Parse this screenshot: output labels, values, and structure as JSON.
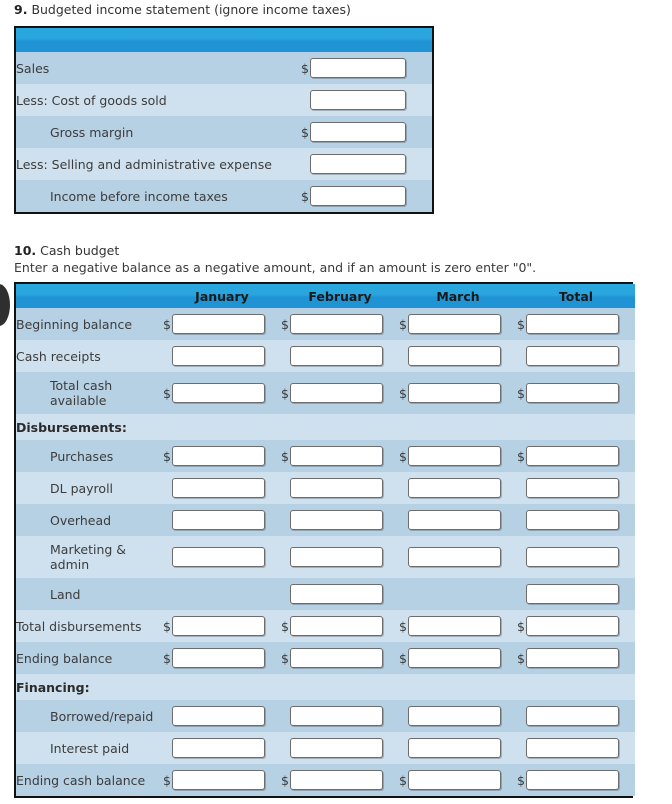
{
  "questions": {
    "q9": {
      "number": "9.",
      "title": "Budgeted income statement (ignore income taxes)",
      "table": {
        "headers": [
          "",
          ""
        ],
        "rows": [
          {
            "label": "Sales",
            "indent": false,
            "bold": false,
            "dollar": true,
            "input": true
          },
          {
            "label": "Less: Cost of goods sold",
            "indent": false,
            "bold": false,
            "dollar": false,
            "input": true
          },
          {
            "label": "Gross margin",
            "indent": true,
            "bold": false,
            "dollar": true,
            "input": true
          },
          {
            "label": "Less: Selling and administrative expense",
            "indent": false,
            "bold": false,
            "dollar": false,
            "input": true
          },
          {
            "label": "Income before income taxes",
            "indent": true,
            "bold": false,
            "dollar": true,
            "input": true
          }
        ]
      }
    },
    "q10": {
      "number": "10.",
      "title": "Cash budget",
      "instruction": "Enter a negative balance as a negative amount, and if an amount is zero enter \"0\".",
      "table": {
        "headers": [
          "",
          "January",
          "February",
          "March",
          "Total"
        ],
        "rows": [
          {
            "label": "Beginning balance",
            "indent": false,
            "bold": false,
            "tall": false,
            "cells": [
              {
                "dollar": true,
                "input": true
              },
              {
                "dollar": true,
                "input": true
              },
              {
                "dollar": true,
                "input": true
              },
              {
                "dollar": true,
                "input": true
              }
            ]
          },
          {
            "label": "Cash receipts",
            "indent": false,
            "bold": false,
            "tall": false,
            "cells": [
              {
                "dollar": false,
                "input": true
              },
              {
                "dollar": false,
                "input": true
              },
              {
                "dollar": false,
                "input": true
              },
              {
                "dollar": false,
                "input": true
              }
            ]
          },
          {
            "label": "Total cash available",
            "indent": true,
            "bold": false,
            "tall": true,
            "cells": [
              {
                "dollar": true,
                "input": true
              },
              {
                "dollar": true,
                "input": true
              },
              {
                "dollar": true,
                "input": true
              },
              {
                "dollar": true,
                "input": true
              }
            ]
          },
          {
            "label": "Disbursements:",
            "indent": false,
            "bold": true,
            "tall": false,
            "thin": true,
            "cells": [
              {
                "dollar": false,
                "input": false
              },
              {
                "dollar": false,
                "input": false
              },
              {
                "dollar": false,
                "input": false
              },
              {
                "dollar": false,
                "input": false
              }
            ]
          },
          {
            "label": "Purchases",
            "indent": true,
            "bold": false,
            "tall": false,
            "cells": [
              {
                "dollar": true,
                "input": true
              },
              {
                "dollar": true,
                "input": true
              },
              {
                "dollar": true,
                "input": true
              },
              {
                "dollar": true,
                "input": true
              }
            ]
          },
          {
            "label": "DL payroll",
            "indent": true,
            "bold": false,
            "tall": false,
            "cells": [
              {
                "dollar": false,
                "input": true
              },
              {
                "dollar": false,
                "input": true
              },
              {
                "dollar": false,
                "input": true
              },
              {
                "dollar": false,
                "input": true
              }
            ]
          },
          {
            "label": "Overhead",
            "indent": true,
            "bold": false,
            "tall": false,
            "cells": [
              {
                "dollar": false,
                "input": true
              },
              {
                "dollar": false,
                "input": true
              },
              {
                "dollar": false,
                "input": true
              },
              {
                "dollar": false,
                "input": true
              }
            ]
          },
          {
            "label": "Marketing & admin",
            "indent": true,
            "bold": false,
            "tall": true,
            "cells": [
              {
                "dollar": false,
                "input": true
              },
              {
                "dollar": false,
                "input": true
              },
              {
                "dollar": false,
                "input": true
              },
              {
                "dollar": false,
                "input": true
              }
            ]
          },
          {
            "label": "Land",
            "indent": true,
            "bold": false,
            "tall": false,
            "cells": [
              {
                "dollar": false,
                "input": false
              },
              {
                "dollar": false,
                "input": true
              },
              {
                "dollar": false,
                "input": false
              },
              {
                "dollar": false,
                "input": true
              }
            ]
          },
          {
            "label": "Total disbursements",
            "indent": false,
            "bold": false,
            "tall": false,
            "cells": [
              {
                "dollar": true,
                "input": true
              },
              {
                "dollar": true,
                "input": true
              },
              {
                "dollar": true,
                "input": true
              },
              {
                "dollar": true,
                "input": true
              }
            ]
          },
          {
            "label": "Ending balance",
            "indent": false,
            "bold": false,
            "tall": false,
            "cells": [
              {
                "dollar": true,
                "input": true
              },
              {
                "dollar": true,
                "input": true
              },
              {
                "dollar": true,
                "input": true
              },
              {
                "dollar": true,
                "input": true
              }
            ]
          },
          {
            "label": "Financing:",
            "indent": false,
            "bold": true,
            "tall": false,
            "thin": true,
            "cells": [
              {
                "dollar": false,
                "input": false
              },
              {
                "dollar": false,
                "input": false
              },
              {
                "dollar": false,
                "input": false
              },
              {
                "dollar": false,
                "input": false
              }
            ]
          },
          {
            "label": "Borrowed/repaid",
            "indent": true,
            "bold": false,
            "tall": false,
            "cells": [
              {
                "dollar": false,
                "input": true
              },
              {
                "dollar": false,
                "input": true
              },
              {
                "dollar": false,
                "input": true
              },
              {
                "dollar": false,
                "input": true
              }
            ]
          },
          {
            "label": "Interest paid",
            "indent": true,
            "bold": false,
            "tall": false,
            "cells": [
              {
                "dollar": false,
                "input": true
              },
              {
                "dollar": false,
                "input": true
              },
              {
                "dollar": false,
                "input": true
              },
              {
                "dollar": false,
                "input": true
              }
            ]
          },
          {
            "label": "Ending cash balance",
            "indent": false,
            "bold": false,
            "tall": false,
            "cells": [
              {
                "dollar": true,
                "input": true
              },
              {
                "dollar": true,
                "input": true
              },
              {
                "dollar": true,
                "input": true
              },
              {
                "dollar": true,
                "input": true
              }
            ]
          }
        ]
      }
    }
  },
  "field": {
    "placeholder": "",
    "value": ""
  },
  "symbols": {
    "dollar": "$"
  },
  "colors": {
    "header_blue": "#2ba4dd",
    "row_dark": "#b6d0e4",
    "row_light": "#cfe1ef",
    "border_dark": "#111111",
    "text": "#3c3c3c"
  }
}
